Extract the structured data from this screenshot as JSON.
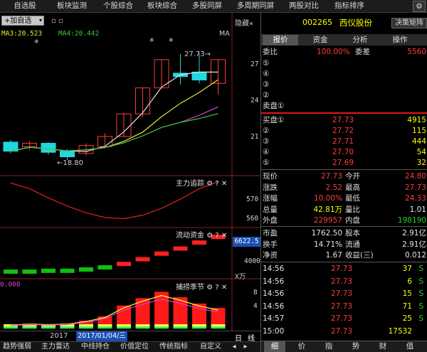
{
  "topnav": {
    "items": [
      "自选股",
      "板块监测",
      "个股综合",
      "板块综合",
      "多股同屏",
      "多周期同屏",
      "两股对比",
      "指标排序"
    ],
    "settings_icon": "gear-icon"
  },
  "main_chart": {
    "add_watch_label": "+加自选",
    "hide_label": "隐藏«",
    "ma3_label": "MA3:20.523",
    "ma4_label": "MA4:20.442",
    "ma_label": "MA",
    "high_marker": "27.73",
    "low_marker": "18.80",
    "star_marker": "*",
    "y_ticks": [
      "27",
      "24",
      "21"
    ],
    "colors": {
      "up": "#ff3b3b",
      "down": "#20d8e0",
      "ma_white": "#e0e0e0",
      "ma_yellow": "#e6e633",
      "ma_magenta": "#d43fd4",
      "ma_green": "#33cc33"
    }
  },
  "chart_data": {
    "type": "line",
    "title": "",
    "candles": [
      {
        "o": 20.4,
        "c": 19.6,
        "h": 20.6,
        "l": 19.4
      },
      {
        "o": 20.0,
        "c": 20.3,
        "h": 20.5,
        "l": 19.7
      },
      {
        "o": 20.3,
        "c": 19.5,
        "h": 20.4,
        "l": 19.3
      },
      {
        "o": 19.6,
        "c": 19.1,
        "h": 19.8,
        "l": 18.8
      },
      {
        "o": 19.4,
        "c": 20.1,
        "h": 20.3,
        "l": 19.2
      },
      {
        "o": 20.0,
        "c": 20.9,
        "h": 21.2,
        "l": 19.9
      },
      {
        "o": 20.9,
        "c": 22.9,
        "h": 23.0,
        "l": 20.9
      },
      {
        "o": 22.9,
        "c": 25.2,
        "h": 25.2,
        "l": 22.6
      },
      {
        "o": 25.2,
        "c": 27.7,
        "h": 27.7,
        "l": 25.2
      },
      {
        "o": 26.5,
        "c": 26.2,
        "h": 28.2,
        "l": 25.5
      },
      {
        "o": 26.6,
        "c": 25.9,
        "h": 28.3,
        "l": 25.6
      },
      {
        "o": 25.6,
        "c": 27.7,
        "h": 27.7,
        "l": 24.6
      }
    ],
    "main_range": [
      18.0,
      28.7
    ],
    "trend_series": [
      588,
      583,
      575,
      568,
      562,
      558,
      557,
      560,
      566,
      574,
      583,
      589
    ],
    "trend_range": [
      553,
      590
    ],
    "capital_series": [
      -1500,
      -1500,
      -1300,
      -1300,
      -1000,
      -500,
      300,
      1400,
      2700,
      3900,
      5300,
      6622.5
    ],
    "capital_range": [
      -2500,
      7800
    ],
    "season_series": [
      0.8,
      1.0,
      0.9,
      1.0,
      1.6,
      2.5,
      4.7,
      6.2,
      7.5,
      6.4,
      5.1,
      4.2
    ],
    "season_range": [
      0,
      9
    ]
  },
  "trend_panel": {
    "title": "主力追踪",
    "y_ticks": [
      "570",
      "560"
    ]
  },
  "capital_panel": {
    "title": "流动资金",
    "value_badge": "6622.5",
    "y_ticks": [
      "4000"
    ],
    "unit": "X万"
  },
  "season_panel": {
    "title": "捕捞季节",
    "left_value": "0.000",
    "y_ticks": [
      "8",
      "4"
    ]
  },
  "date_bar": {
    "year": "2017",
    "date": "2017/01/04/三",
    "day_label": "日",
    "line_label": "线"
  },
  "bottom_tabs": [
    "趋势强弱",
    "主力雷达",
    "中线持仓",
    "价值定位",
    "传统指标",
    "自定义"
  ],
  "right_panel": {
    "code": "002265",
    "name": "西仪股份",
    "decision_btn": "决策矩阵",
    "tabs": [
      "报价",
      "资金",
      "分析",
      "操作"
    ],
    "weibi_label": "委比",
    "weibi_value": "100.00%",
    "weicha_label": "委差",
    "weicha_value": "5560",
    "sell_rows": [
      {
        "label": "⑤",
        "price": "",
        "vol": ""
      },
      {
        "label": "④",
        "price": "",
        "vol": ""
      },
      {
        "label": "③",
        "price": "",
        "vol": ""
      },
      {
        "label": "②",
        "price": "",
        "vol": ""
      },
      {
        "label": "卖盘①",
        "price": "",
        "vol": ""
      }
    ],
    "buy_rows": [
      {
        "label": "买盘①",
        "price": "27.73",
        "vol": "4915"
      },
      {
        "label": "②",
        "price": "27.72",
        "vol": "115"
      },
      {
        "label": "③",
        "price": "27.71",
        "vol": "444"
      },
      {
        "label": "④",
        "price": "27.70",
        "vol": "54"
      },
      {
        "label": "⑤",
        "price": "27.69",
        "vol": "32"
      }
    ],
    "stats": [
      {
        "l1": "现价",
        "v1": "27.73",
        "c1": "red",
        "l2": "今开",
        "v2": "24.80",
        "c2": "red"
      },
      {
        "l1": "涨跌",
        "v1": "2.52",
        "c1": "red",
        "l2": "最高",
        "v2": "27.73",
        "c2": "red"
      },
      {
        "l1": "涨幅",
        "v1": "10.00%",
        "c1": "red",
        "l2": "最低",
        "v2": "24.33",
        "c2": "red"
      },
      {
        "l1": "总量",
        "v1": "42.81万",
        "c1": "yel",
        "l2": "量比",
        "v2": "1.01",
        "c2": "wht"
      },
      {
        "l1": "外盘",
        "v1": "229957",
        "c1": "red",
        "l2": "内盘",
        "v2": "198190",
        "c2": "grn"
      }
    ],
    "stats2": [
      {
        "l1": "市盈",
        "v1": "1762.50",
        "l2": "股本",
        "v2": "2.91亿"
      },
      {
        "l1": "换手",
        "v1": "14.71%",
        "l2": "流通",
        "v2": "2.91亿"
      },
      {
        "l1": "净资",
        "v1": "1.67",
        "l2": "收益(三)",
        "v2": "0.012"
      }
    ],
    "ticks": [
      {
        "time": "14:56",
        "price": "27.73",
        "vol": "37",
        "flag": "S"
      },
      {
        "time": "14:56",
        "price": "27.73",
        "vol": "6",
        "flag": "S"
      },
      {
        "time": "14:56",
        "price": "27.73",
        "vol": "15",
        "flag": "S"
      },
      {
        "time": "14:56",
        "price": "27.73",
        "vol": "71",
        "flag": "S"
      },
      {
        "time": "14:57",
        "price": "27.73",
        "vol": "25",
        "flag": "S"
      },
      {
        "time": "15:00",
        "price": "27.73",
        "vol": "17532",
        "flag": ""
      }
    ],
    "bottom_tabs": [
      "细",
      "价",
      "指",
      "势",
      "财",
      "值"
    ]
  }
}
